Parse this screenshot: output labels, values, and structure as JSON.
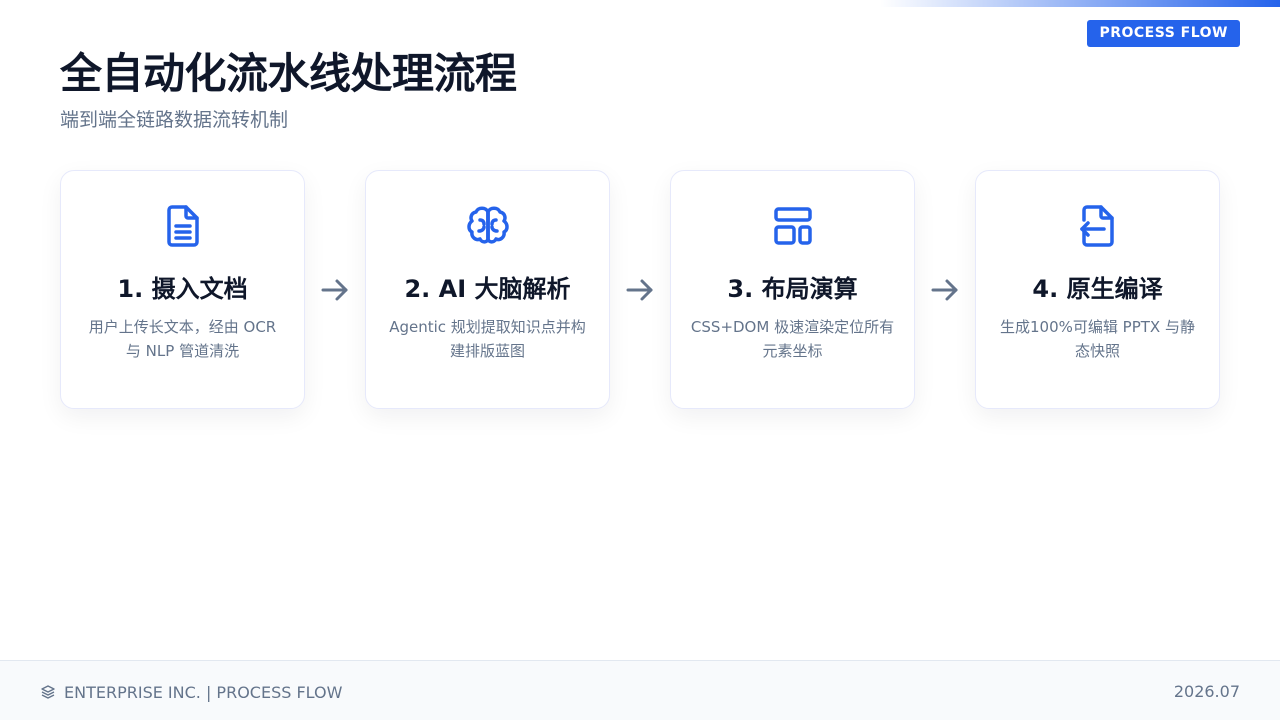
{
  "header": {
    "badge": "PROCESS FLOW",
    "title": "全自动化流水线处理流程",
    "subtitle": "端到端全链路数据流转机制"
  },
  "accent_color": "#2563eb",
  "steps": [
    {
      "icon": "document-icon",
      "title": "1. 摄入文档",
      "desc": "用户上传长文本，经由 OCR 与 NLP 管道清洗"
    },
    {
      "icon": "brain-icon",
      "title": "2. AI 大脑解析",
      "desc": "Agentic 规划提取知识点并构建排版蓝图"
    },
    {
      "icon": "layout-icon",
      "title": "3. 布局演算",
      "desc": "CSS+DOM 极速渲染定位所有元素坐标"
    },
    {
      "icon": "file-export-icon",
      "title": "4. 原生编译",
      "desc": "生成100%可编辑 PPTX 与静态快照"
    }
  ],
  "footer": {
    "left_icon": "layers-icon",
    "left_text": "ENTERPRISE INC. | PROCESS FLOW",
    "right_text": "2026.07"
  }
}
